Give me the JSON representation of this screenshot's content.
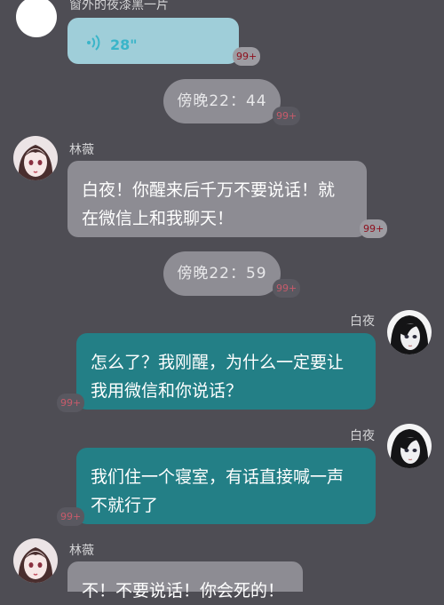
{
  "messages": [
    {
      "sender": "窗外的夜漆黑一片",
      "voice": {
        "duration": "28\""
      },
      "badge": "99+"
    },
    {
      "time": "傍晚22：44",
      "badge": "99+"
    },
    {
      "sender": "林薇",
      "text_lines": [
        "白夜！你醒来后千万不要说话！就",
        "在微信上和我聊天！"
      ],
      "badge": "99+"
    },
    {
      "time": "傍晚22：59",
      "badge": "99+"
    },
    {
      "sender": "白夜",
      "text_lines": [
        "怎么了？我刚醒，为什么一定要让",
        "我用微信和你说话？"
      ],
      "badge": "99+"
    },
    {
      "sender": "白夜",
      "text_lines": [
        "我们住一个寝室，有话直接喊一声",
        "不就行了"
      ],
      "badge": "99+"
    },
    {
      "sender": "林薇",
      "text_lines": [
        "不！不要说话！你会死的！"
      ]
    }
  ],
  "colors": {
    "background": "#4e4d54",
    "left_bubble": "#8d8c93",
    "right_bubble": "#237f86",
    "voice_bubble": "#9fced9",
    "voice_text": "#3ab5c9"
  },
  "icons": [
    "voice-wave-icon"
  ]
}
